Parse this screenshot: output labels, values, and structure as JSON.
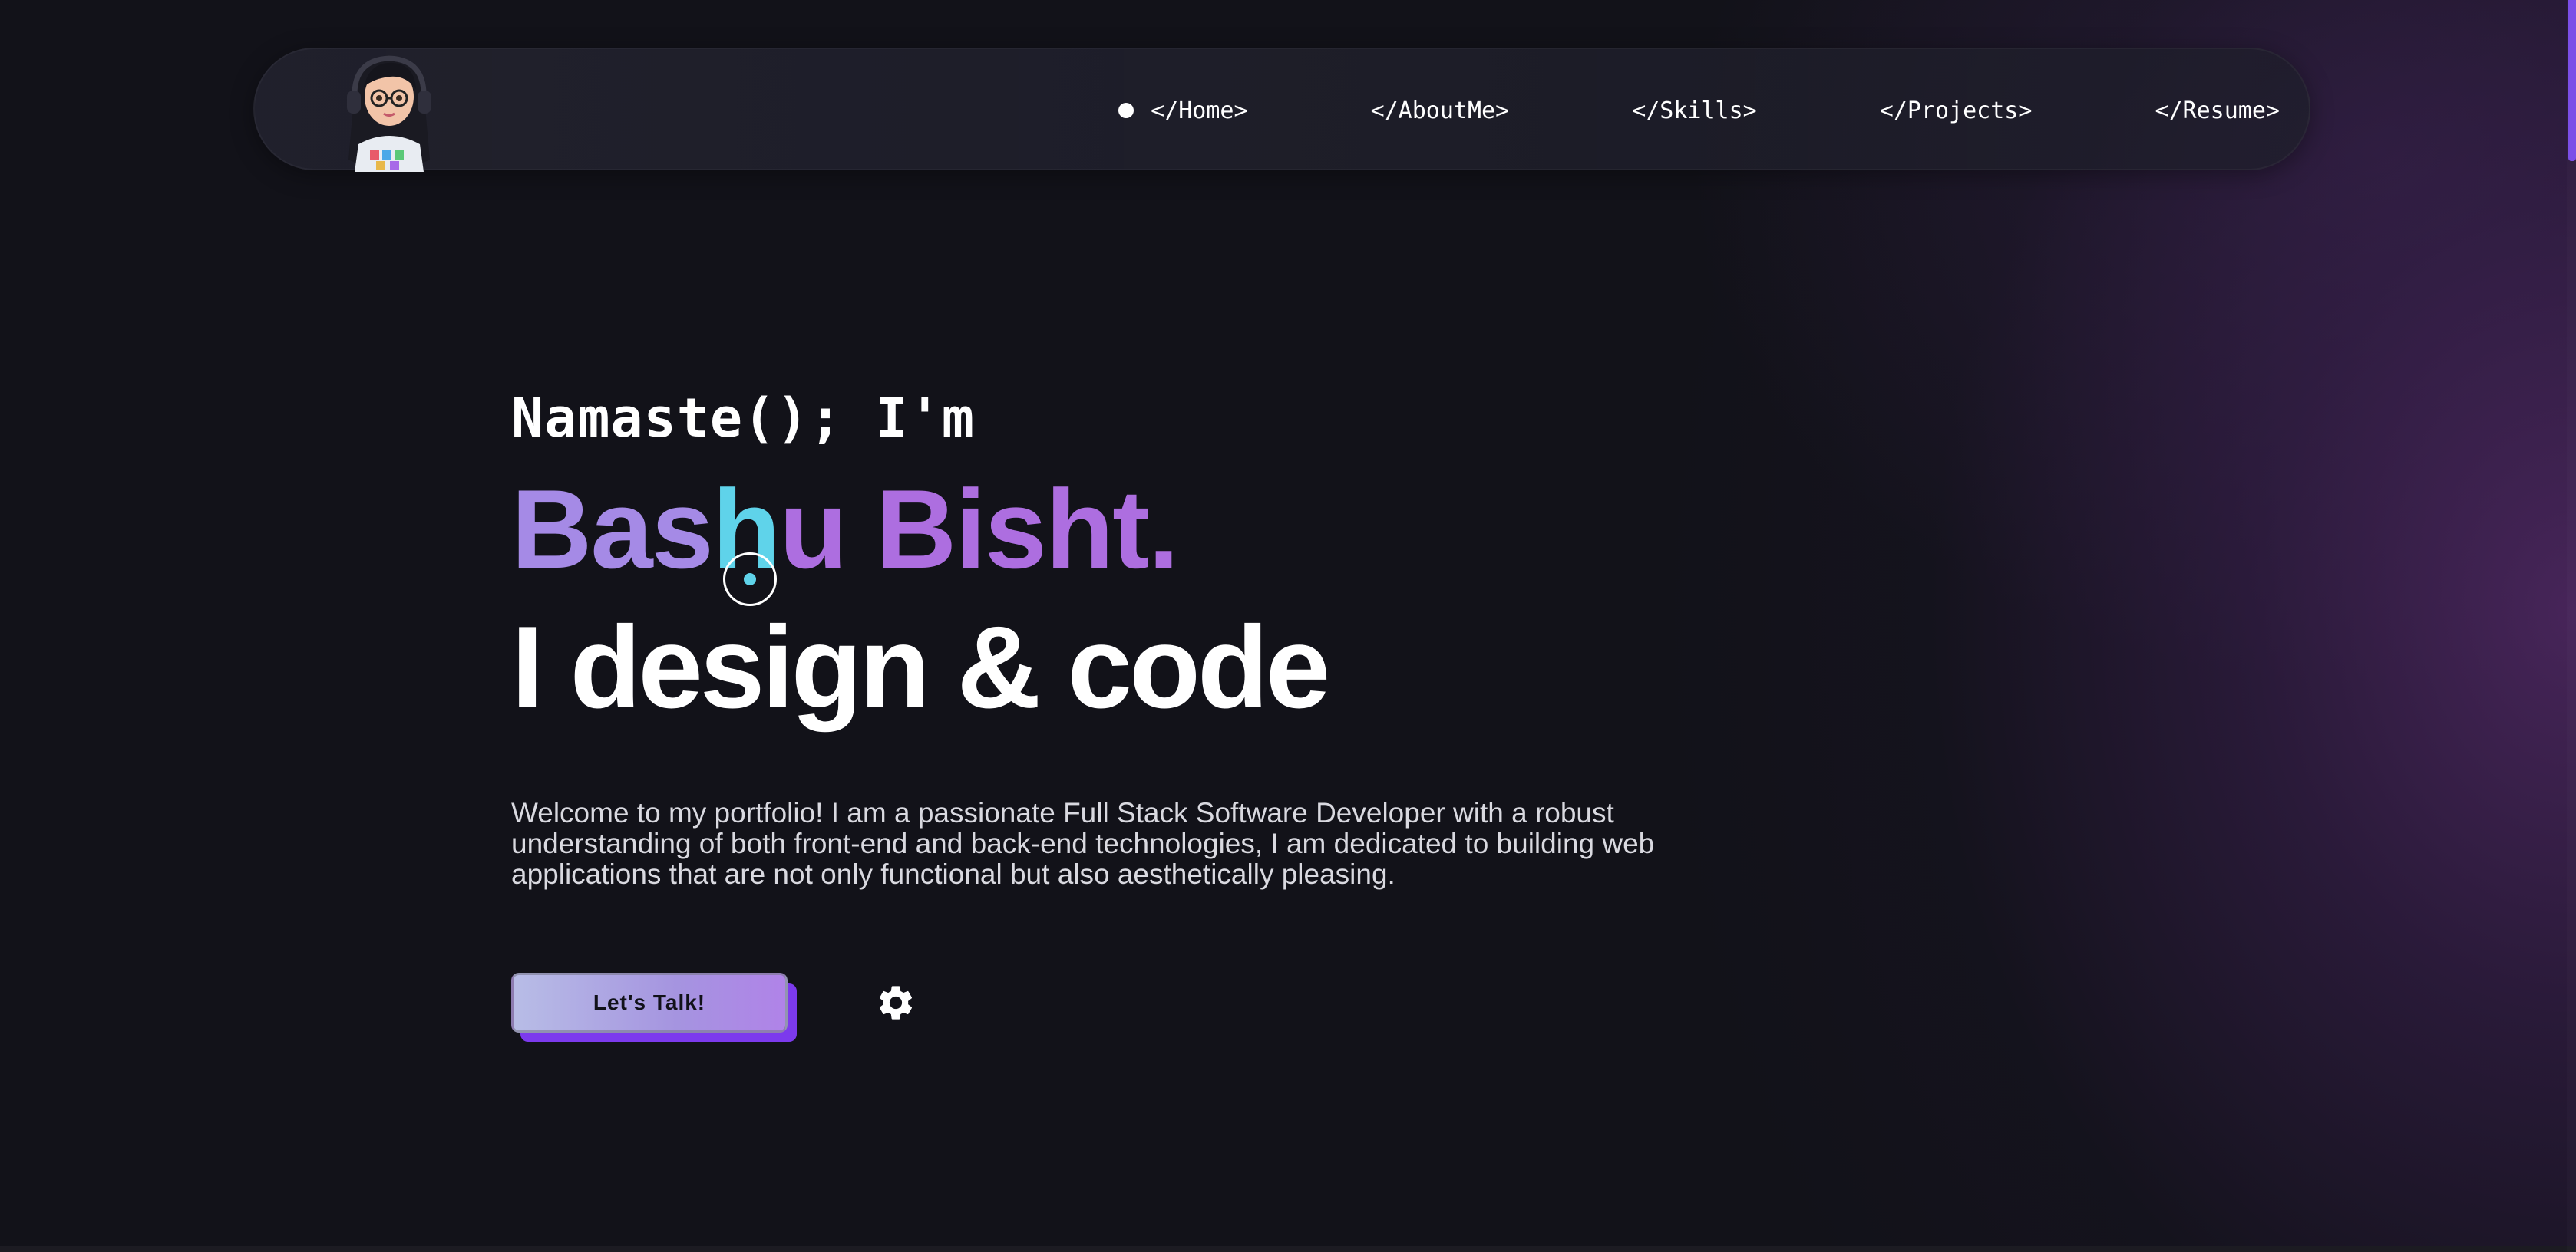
{
  "nav": {
    "items": [
      {
        "label": "</Home>",
        "active": true
      },
      {
        "label": "</AboutMe>",
        "active": false
      },
      {
        "label": "</Skills>",
        "active": false
      },
      {
        "label": "</Projects>",
        "active": false
      },
      {
        "label": "</Resume>",
        "active": false
      }
    ],
    "avatar_icon": "avatar-with-headphones-icon"
  },
  "hero": {
    "greeting": "Namaste(); I'm",
    "name_part1": "Bas",
    "name_part2": "h",
    "name_part3": "u Bisht.",
    "tagline": "I design & code",
    "intro": "Welcome to my portfolio! I am a passionate Full Stack Software Developer with a robust understanding of both front-end and back-end technologies, I am dedicated to building web applications that are not only functional but also aesthetically pleasing.",
    "cta_label": "Let's Talk!",
    "settings_icon": "gear-icon"
  },
  "colors": {
    "background": "#121219",
    "accent_purple": "#7c3aed",
    "name_lavender": "#a58ae6",
    "name_cyan": "#5fd3ea",
    "name_violet": "#ad6ee0"
  }
}
